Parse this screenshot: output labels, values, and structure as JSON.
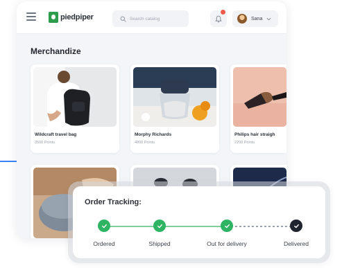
{
  "app": {
    "logo_text": "piedpiper",
    "search_placeholder": "Search catalog",
    "user_name": "Sana",
    "brand_color": "#2e9c4d",
    "notification_badge_color": "#ef5a4a"
  },
  "main": {
    "title": "Merchandize",
    "products": [
      {
        "name": "Wildcraft travel bag",
        "points": "3500 Points",
        "icon": "backpack-image"
      },
      {
        "name": "Morphy Richards",
        "points": "4800 Points",
        "icon": "chopper-image"
      },
      {
        "name": "Philips hair straigh",
        "points": "2200 Points",
        "icon": "hair-brush-image"
      },
      {
        "name": "",
        "points": "",
        "icon": "smart-speaker-image"
      },
      {
        "name": "",
        "points": "",
        "icon": "earbuds-image"
      },
      {
        "name": "",
        "points": "",
        "icon": "cable-image"
      }
    ]
  },
  "tracking": {
    "title": "Order Tracking:",
    "steps": [
      {
        "label": "Ordered",
        "status": "done"
      },
      {
        "label": "Shipped",
        "status": "done"
      },
      {
        "label": "Out for delivery",
        "status": "done"
      },
      {
        "label": "Delivered",
        "status": "current"
      }
    ],
    "done_color": "#2fb463",
    "current_color": "#1f2430"
  }
}
